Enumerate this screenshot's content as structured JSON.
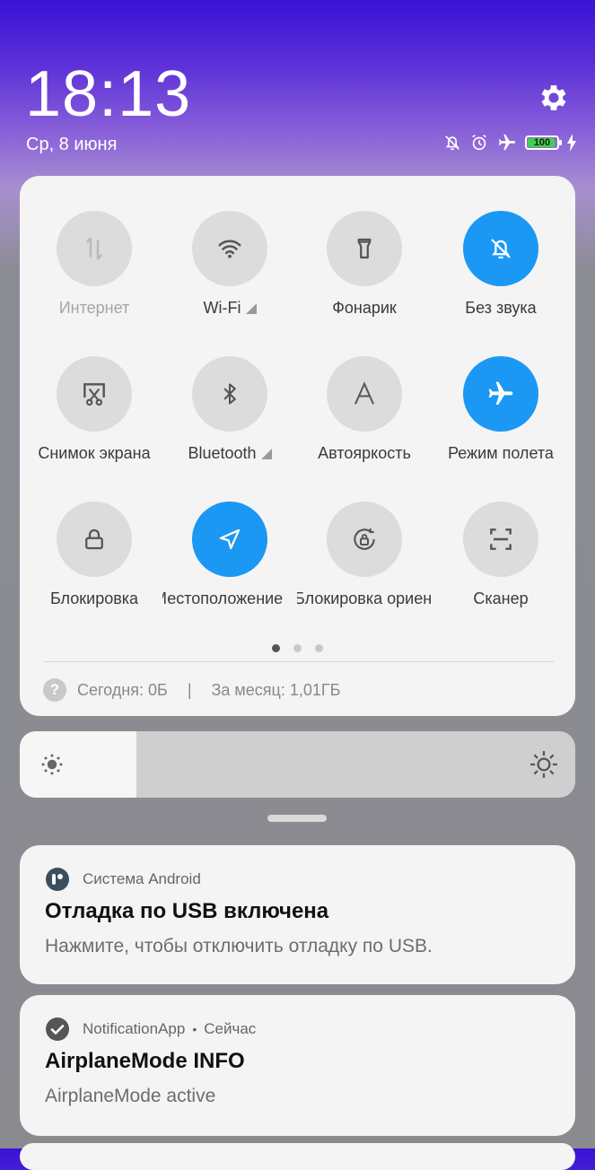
{
  "lockscreen": {
    "time": "18:13",
    "date": "Ср, 8 июня",
    "battery_level": "100",
    "battery_fraction": 1.0,
    "status_icons": [
      "mute-icon",
      "alarm-icon",
      "airplane-icon",
      "battery-icon",
      "charging-icon"
    ]
  },
  "quick_settings": {
    "tiles": [
      {
        "label": "Интернет",
        "icon": "data-transfer-icon",
        "state": "disabled"
      },
      {
        "label": "Wi-Fi",
        "icon": "wifi-icon",
        "state": "off"
      },
      {
        "label": "Фонарик",
        "icon": "flashlight-icon",
        "state": "off"
      },
      {
        "label": "Без звука",
        "icon": "silent-icon",
        "state": "on"
      },
      {
        "label": "Снимок экрана",
        "icon": "screenshot-icon",
        "state": "off"
      },
      {
        "label": "Bluetooth",
        "icon": "bluetooth-icon",
        "state": "off"
      },
      {
        "label": "Автояркость",
        "icon": "auto-brightness-icon",
        "state": "off"
      },
      {
        "label": "Режим полета",
        "icon": "airplane-icon",
        "state": "on"
      },
      {
        "label": "Блокировка",
        "icon": "lock-icon",
        "state": "off"
      },
      {
        "label": "Местоположение",
        "icon": "location-icon",
        "state": "on"
      },
      {
        "label": "Блокировка ориентации",
        "icon": "rotation-lock-icon",
        "state": "off"
      },
      {
        "label": "Сканер",
        "icon": "scanner-icon",
        "state": "off"
      }
    ],
    "page_count": 3,
    "current_page": 1,
    "usage_today": "Сегодня: 0Б",
    "usage_separator": "|",
    "usage_month": "За месяц: 1,01ГБ"
  },
  "brightness": {
    "level": 0.21
  },
  "notifications": [
    {
      "app": "Система Android",
      "title": "Отладка по USB включена",
      "body": "Нажмите, чтобы отключить отладку по USB.",
      "icon": "android-system-icon"
    },
    {
      "app": "NotificationApp",
      "time_sep": "•",
      "time": "Сейчас",
      "title": "AirplaneMode INFO",
      "body": "AirplaneMode active",
      "icon": "check-circle-icon"
    }
  ],
  "colors": {
    "accent": "#1a98f4",
    "tile_off": "#dcdcdc",
    "panel": "#f4f4f4"
  }
}
